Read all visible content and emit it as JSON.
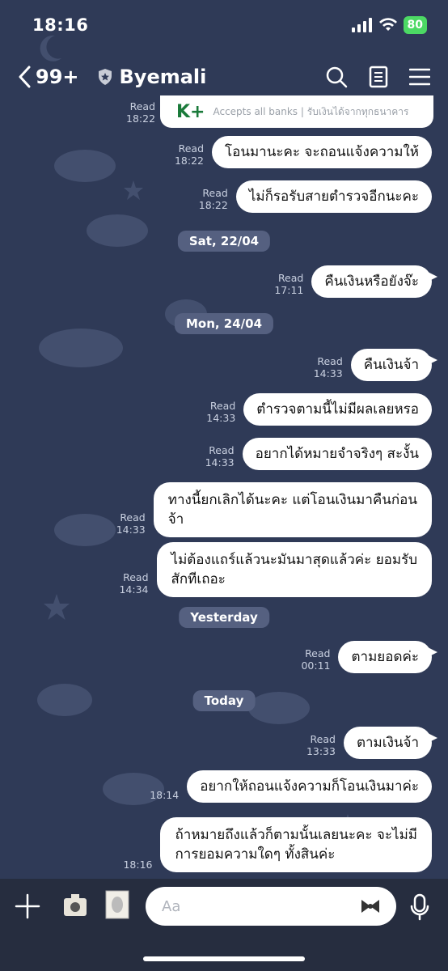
{
  "status": {
    "time": "18:16",
    "battery": "80"
  },
  "header": {
    "back_count": "99+",
    "title": "Byemali"
  },
  "card": {
    "logo": "K+",
    "text": "Accepts all banks | รับเงินได้จากทุกธนาคาร",
    "read": "Read",
    "time": "18:22"
  },
  "messages": [
    {
      "text": "โอนมานะคะ จะถอนแจ้งความให้",
      "read": "Read",
      "time": "18:22"
    },
    {
      "text": "ไม่ก็รอรับสายตำรวจอีกนะคะ",
      "read": "Read",
      "time": "18:22"
    },
    {
      "text": "คืนเงินหรือยังจ๊ะ",
      "read": "Read",
      "time": "17:11"
    },
    {
      "text": "คืนเงินจ้า",
      "read": "Read",
      "time": "14:33"
    },
    {
      "text": "ตำรวจตามนี้ไม่มีผลเลยหรอ",
      "read": "Read",
      "time": "14:33"
    },
    {
      "text": "อยากได้หมายจำจริงๆ สะงั้น",
      "read": "Read",
      "time": "14:33"
    },
    {
      "line1": "ทางนี้ยกเลิกได้นะคะ แต่โอนเงินมาคืนก่อน",
      "line2": "จ้า",
      "read": "Read",
      "time": "14:33"
    },
    {
      "line1": "ไม่ต้องแถร์แล้วนะมันมาสุดแล้วค่ะ ยอมรับ",
      "line2": "สักทีเถอะ",
      "read": "Read",
      "time": "14:34"
    },
    {
      "text": "ตามยอดค่ะ",
      "read": "Read",
      "time": "00:11"
    },
    {
      "text": "ตามเงินจ้า",
      "read": "Read",
      "time": "13:33"
    },
    {
      "text": "อยากให้ถอนแจ้งความก็โอนเงินมาค่ะ",
      "read": "",
      "time": "18:14"
    },
    {
      "line1": "ถ้าหมายถึงแล้วก็ตามนั้นเลยนะคะ จะไม่มี",
      "line2": "การยอมความใดๆ ทั้งสินค่ะ",
      "read": "",
      "time": "18:16"
    }
  ],
  "dates": [
    "Sat, 22/04",
    "Mon, 24/04",
    "Yesterday",
    "Today"
  ],
  "input": {
    "placeholder": "Aa"
  },
  "icons": [
    "back-chevron-icon",
    "shield-icon",
    "search-icon",
    "notes-icon",
    "menu-icon",
    "plus-icon",
    "sticker-icon",
    "mic-icon"
  ],
  "colors": {
    "background": "#2f3a57",
    "bubble": "#ffffff",
    "date_chip": "#556080",
    "bottom_bar": "#262d3f",
    "battery": "#4cd964"
  }
}
